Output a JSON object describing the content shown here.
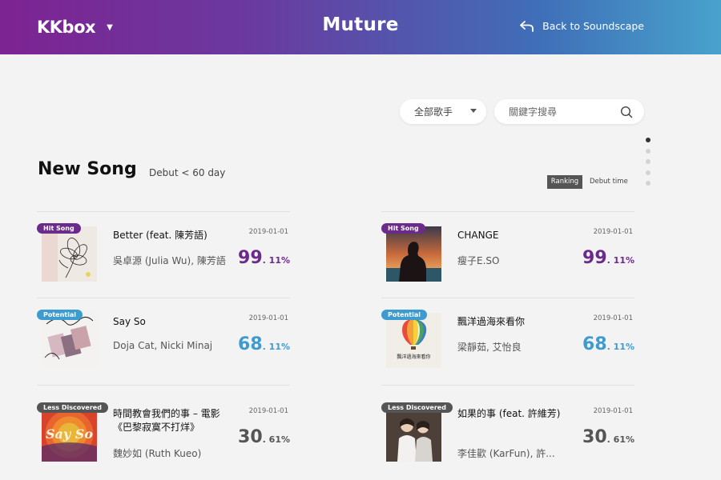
{
  "header": {
    "logo": "KKbox",
    "title": "Muture",
    "back_label": "Back to Soundscape"
  },
  "filters": {
    "artist_select": "全部歌手",
    "search_placeholder": "關鍵字搜尋"
  },
  "section": {
    "title": "New Song",
    "subtitle": "Debut < 60 day",
    "sort_ranking": "Ranking",
    "sort_debut": "Debut time"
  },
  "pager": {
    "count": 5,
    "active_index": 0
  },
  "songs": [
    {
      "badge": "Hit Song",
      "badge_type": "hit",
      "date": "2019-01-01",
      "title": "Better (feat. 陳芳語)",
      "artist": "吳卓源 (Julia Wu), 陳芳語",
      "score_int": "99",
      "score_dec": ". 11%",
      "color": "#6b2b8a"
    },
    {
      "badge": "Hit Song",
      "badge_type": "hit",
      "date": "2019-01-01",
      "title": "CHANGE",
      "artist": "瘦子E.SO",
      "score_int": "99",
      "score_dec": ". 11%",
      "color": "#6b2b8a"
    },
    {
      "badge": "Potential",
      "badge_type": "potential",
      "date": "2019-01-01",
      "title": "Say So",
      "artist": "Doja Cat, Nicki Minaj",
      "score_int": "68",
      "score_dec": ". 11%",
      "color": "#3e9bd0"
    },
    {
      "badge": "Potential",
      "badge_type": "potential",
      "date": "2019-01-01",
      "title": "飄洋過海來看你",
      "artist": "梁靜茹, 艾怡良",
      "score_int": "68",
      "score_dec": ". 11%",
      "color": "#3e9bd0"
    },
    {
      "badge": "Less Discovered",
      "badge_type": "less",
      "date": "2019-01-01",
      "title": "時間教會我們的事 – 電影《巴黎寂寞不打烊》",
      "artist": "魏妙如 (Ruth Kueo)",
      "score_int": "30",
      "score_dec": ". 61%",
      "color": "#555555"
    },
    {
      "badge": "Less Discovered",
      "badge_type": "less",
      "date": "2019-01-01",
      "title": "如果的事 (feat. 許維芳)",
      "artist": "李佳歡 (KarFun), 許...",
      "score_int": "30",
      "score_dec": ". 61%",
      "color": "#555555"
    }
  ],
  "cover_art": {
    "say_so_text": "Say So",
    "piaoyang_text": "飄洋過海來看你"
  }
}
